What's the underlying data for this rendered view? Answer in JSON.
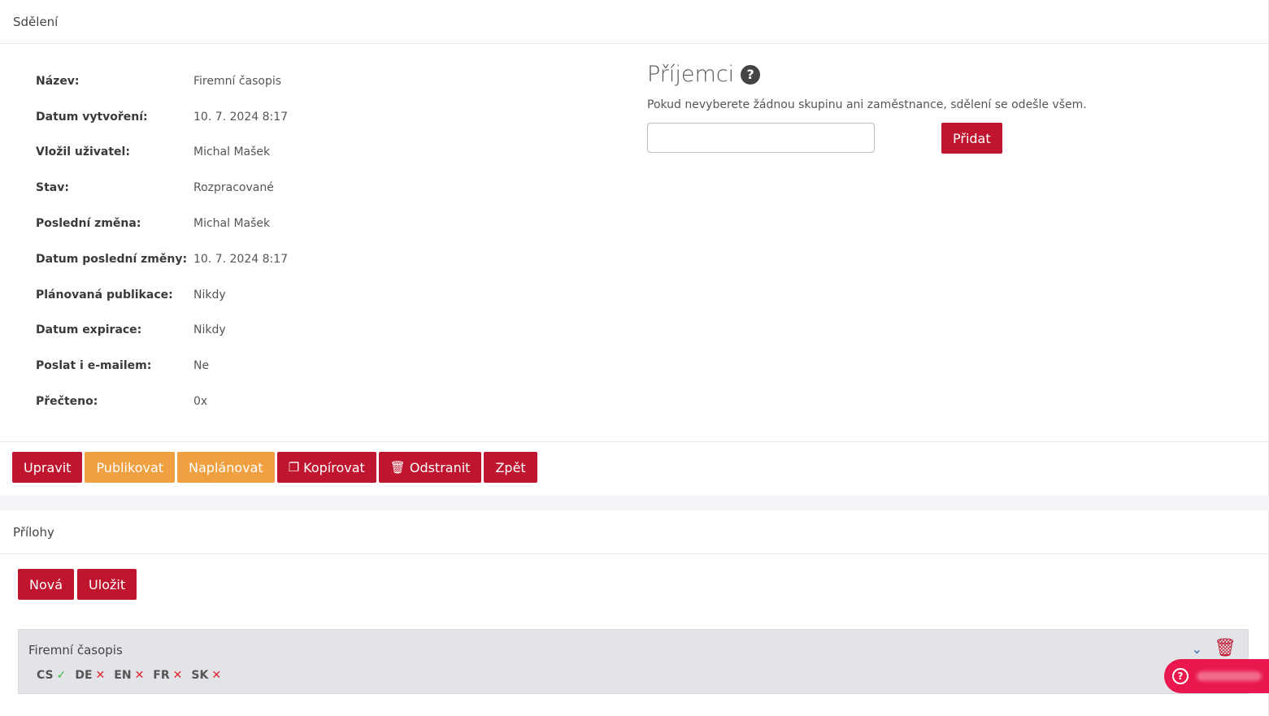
{
  "section1": {
    "title": "Sdělení"
  },
  "details": [
    {
      "label": "Název:",
      "value": "Firemní časopis"
    },
    {
      "label": "Datum vytvoření:",
      "value": "10. 7. 2024 8:17"
    },
    {
      "label": "Vložil uživatel:",
      "value": "Michal Mašek"
    },
    {
      "label": "Stav:",
      "value": "Rozpracované"
    },
    {
      "label": "Poslední změna:",
      "value": "Michal Mašek"
    },
    {
      "label": "Datum poslední změny:",
      "value": "10. 7. 2024 8:17"
    },
    {
      "label": "Plánovaná publikace:",
      "value": "Nikdy"
    },
    {
      "label": "Datum expirace:",
      "value": "Nikdy"
    },
    {
      "label": "Poslat i e-mailem:",
      "value": "Ne"
    },
    {
      "label": "Přečteno:",
      "value": "0x"
    }
  ],
  "recipients": {
    "title": "Příjemci",
    "note": "Pokud nevyberete žádnou skupinu ani zaměstnance, sdělení se odešle všem.",
    "input_value": "",
    "add_label": "Přidat"
  },
  "actions": {
    "edit": "Upravit",
    "publish": "Publikovat",
    "schedule": "Naplánovat",
    "copy": "Kopírovat",
    "delete": "Odstranit",
    "back": "Zpět"
  },
  "section2": {
    "title": "Přílohy"
  },
  "attachments": {
    "new_label": "Nová",
    "save_label": "Uložit",
    "item": {
      "name": "Firemní časopis",
      "languages": [
        {
          "code": "CS",
          "status": "✓"
        },
        {
          "code": "DE",
          "status": "✕"
        },
        {
          "code": "EN",
          "status": "✕"
        },
        {
          "code": "FR",
          "status": "✕"
        },
        {
          "code": "SK",
          "status": "✕"
        }
      ]
    }
  },
  "colors": {
    "primary": "#c0152f",
    "warning": "#f0a040",
    "help_widget": "#e8174d"
  }
}
